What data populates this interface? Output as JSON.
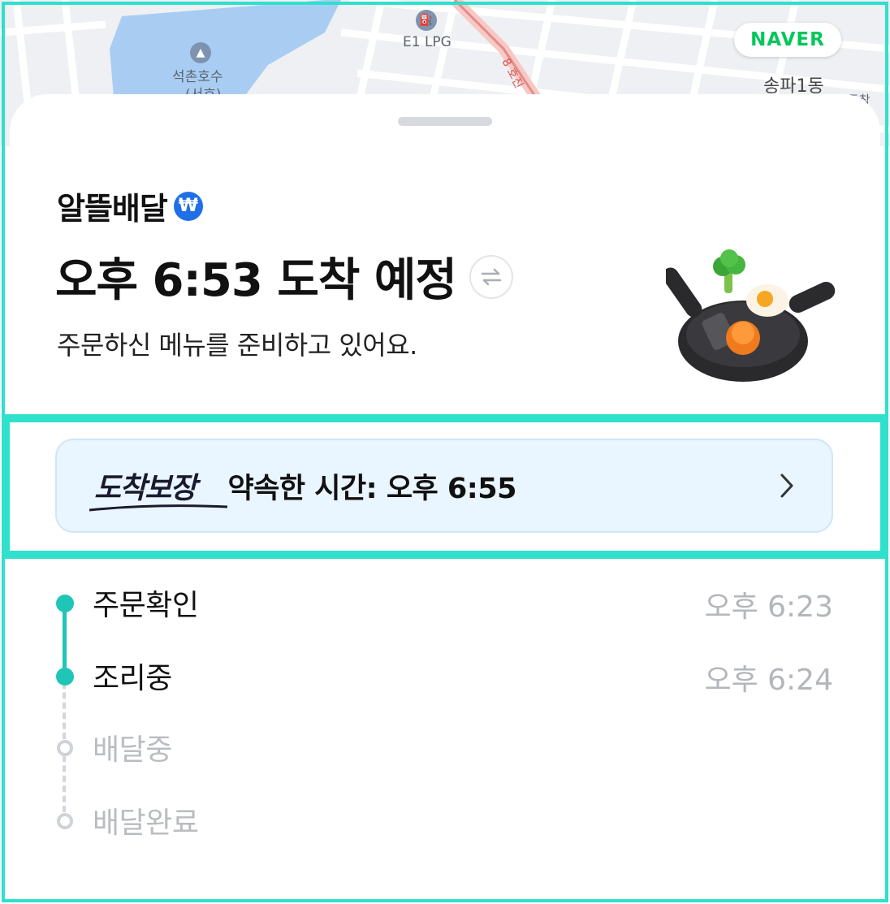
{
  "map": {
    "brand": "NAVER",
    "labels": {
      "lake": "석촌호수",
      "lake_sub": "(서호)",
      "gas_station": "E1 LPG",
      "district": "송파1동",
      "road": "8 호진",
      "partial": "도착"
    }
  },
  "order": {
    "store_name": "알뜰배달",
    "badge_symbol": "₩",
    "eta_title": "오후 6:53 도착 예정",
    "status_message": "주문하신 메뉴를 준비하고 있어요."
  },
  "guarantee": {
    "logo": "도착보장",
    "promise_text": "약속한 시간: 오후 6:55"
  },
  "timeline": {
    "steps": [
      {
        "label": "주문확인",
        "time": "오후 6:23"
      },
      {
        "label": "조리중",
        "time": "오후 6:24"
      },
      {
        "label": "배달중"
      },
      {
        "label": "배달완료"
      }
    ]
  },
  "colors": {
    "accent": "#1fc6b6",
    "frame": "#2fe0cc",
    "banner_bg": "#e9f5ff",
    "naver_green": "#03c75a"
  },
  "icons": [
    "won-icon",
    "swap-icon",
    "chevron-right-icon",
    "gas-station-icon",
    "place-icon",
    "pan-food-icon"
  ]
}
